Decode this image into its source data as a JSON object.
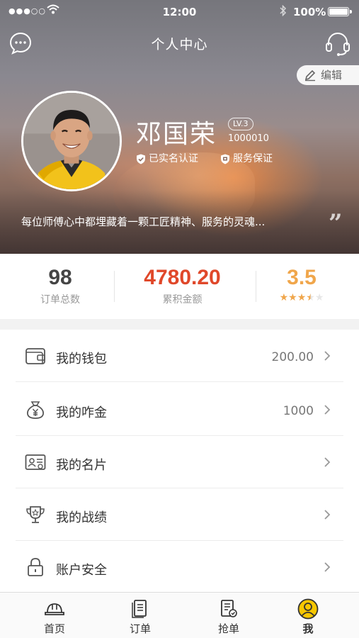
{
  "status_bar": {
    "signal": "●●●○○",
    "time": "12:00",
    "battery": "100%"
  },
  "header": {
    "title": "个人中心",
    "edit_label": "编辑"
  },
  "profile": {
    "name": "邓国荣",
    "level": "LV.3",
    "user_id": "1000010",
    "badges": [
      "已实名认证",
      "服务保证"
    ],
    "motto": "每位师傅心中都埋藏着一颗工匠精神、服务的灵魂..."
  },
  "stats": {
    "orders": {
      "value": "98",
      "label": "订单总数"
    },
    "amount": {
      "value": "4780.20",
      "label": "累积金额"
    },
    "rating": {
      "value": "3.5",
      "stars_filled": 3.5,
      "stars_total": 5
    }
  },
  "menu": [
    {
      "label": "我的钱包",
      "value": "200.00",
      "icon": "wallet-icon"
    },
    {
      "label": "我的咋金",
      "value": "1000",
      "icon": "money-bag-icon"
    },
    {
      "label": "我的名片",
      "value": "",
      "icon": "business-card-icon"
    },
    {
      "label": "我的战绩",
      "value": "",
      "icon": "trophy-icon"
    },
    {
      "label": "账户安全",
      "value": "",
      "icon": "lock-icon"
    }
  ],
  "tabs": [
    {
      "label": "首页",
      "icon": "helmet-icon",
      "active": false
    },
    {
      "label": "订单",
      "icon": "order-document-icon",
      "active": false
    },
    {
      "label": "抢单",
      "icon": "grab-order-icon",
      "active": false
    },
    {
      "label": "我",
      "icon": "user-profile-icon",
      "active": true
    }
  ],
  "colors": {
    "amount": "#e0482a",
    "rating": "#f0a64b",
    "active_tab": "#f6c700"
  }
}
